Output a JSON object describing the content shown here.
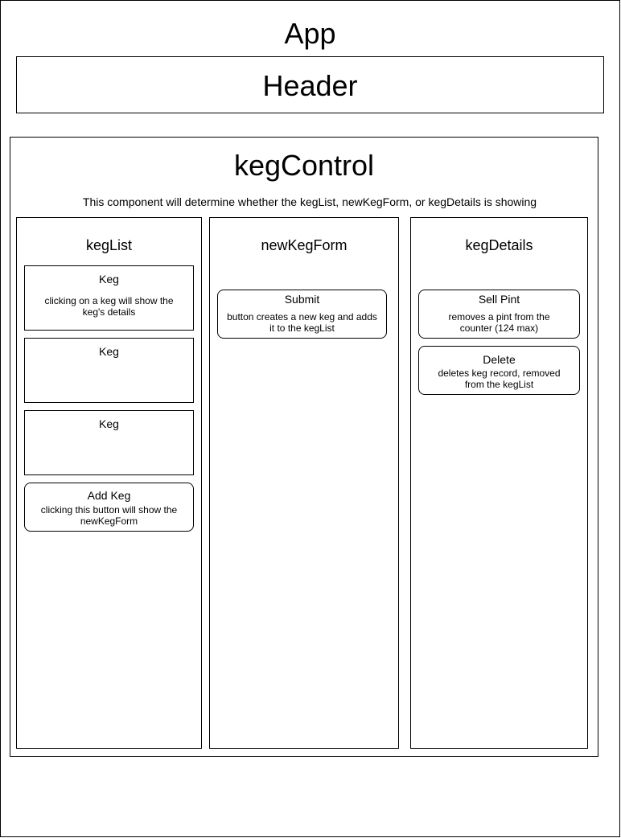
{
  "app": {
    "title": "App"
  },
  "header": {
    "title": "Header"
  },
  "keg_control": {
    "title": "kegControl",
    "description": "This component will determine whether the kegList, newKegForm, or kegDetails is showing"
  },
  "keg_list": {
    "title": "kegList",
    "kegs": [
      {
        "title": "Keg",
        "note_lines": [
          "clicking on a keg will show the",
          "keg's details"
        ]
      },
      {
        "title": "Keg"
      },
      {
        "title": "Keg"
      }
    ],
    "add_keg": {
      "title": "Add Keg",
      "note_lines": [
        "clicking this button will show the",
        "newKegForm"
      ]
    }
  },
  "new_keg_form": {
    "title": "newKegForm",
    "submit": {
      "title": "Submit",
      "note_lines": [
        "button creates a new keg and adds",
        "it to the kegList"
      ]
    }
  },
  "keg_details": {
    "title": "kegDetails",
    "sell_pint": {
      "title": "Sell Pint",
      "note_lines": [
        "removes a pint from the",
        "counter (124 max)"
      ]
    },
    "delete": {
      "title": "Delete",
      "note_lines": [
        "deletes keg record, removed",
        "from the kegList"
      ]
    }
  }
}
